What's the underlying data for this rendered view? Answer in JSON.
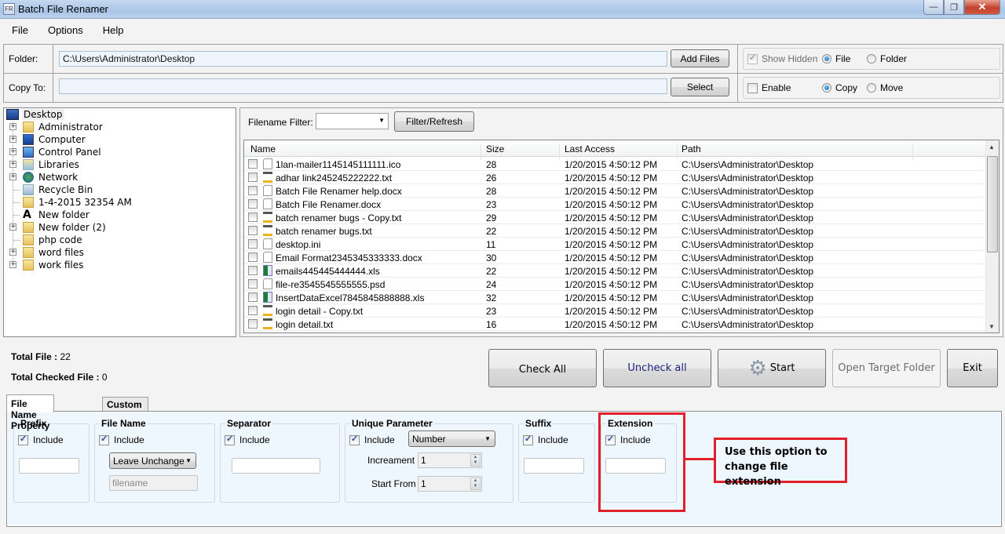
{
  "window": {
    "title": "Batch File Renamer",
    "minimize": "—",
    "restore": "❐",
    "close": "✕"
  },
  "menu": [
    "File",
    "Options",
    "Help"
  ],
  "folder": {
    "label": "Folder:",
    "value": "C:\\Users\\Administrator\\Desktop",
    "button": "Add Files"
  },
  "copy_to": {
    "label": "Copy To:",
    "value": "",
    "button": "Select"
  },
  "options_top": {
    "show_hidden": {
      "label": "Show Hidden",
      "checked": true,
      "disabled": true
    },
    "file": {
      "label": "File",
      "selected": true
    },
    "folder": {
      "label": "Folder",
      "selected": false
    }
  },
  "options_copy": {
    "enable": {
      "label": "Enable",
      "checked": false
    },
    "copy": {
      "label": "Copy",
      "selected": true
    },
    "move": {
      "label": "Move",
      "selected": false
    }
  },
  "tree": {
    "root": "Desktop",
    "items": [
      {
        "label": "Administrator",
        "icon": "user-folder-icon",
        "expandable": true
      },
      {
        "label": "Computer",
        "icon": "computer-icon",
        "expandable": true
      },
      {
        "label": "Control Panel",
        "icon": "control-panel-icon",
        "expandable": true
      },
      {
        "label": "Libraries",
        "icon": "libraries-icon",
        "expandable": true
      },
      {
        "label": "Network",
        "icon": "network-icon",
        "expandable": true
      },
      {
        "label": "Recycle Bin",
        "icon": "recycle-bin-icon",
        "expandable": false
      },
      {
        "label": "1-4-2015 32354 AM",
        "icon": "folder-icon",
        "expandable": false
      },
      {
        "label": "New folder",
        "icon": "font-folder-icon",
        "expandable": false
      },
      {
        "label": "New folder (2)",
        "icon": "folder-icon",
        "expandable": true
      },
      {
        "label": "php code",
        "icon": "folder-icon",
        "expandable": false
      },
      {
        "label": "word files",
        "icon": "folder-icon",
        "expandable": true
      },
      {
        "label": "work files",
        "icon": "folder-icon",
        "expandable": true
      }
    ]
  },
  "filter": {
    "label": "Filename Filter:",
    "value": "",
    "button": "Filter/Refresh"
  },
  "grid": {
    "columns": [
      "Name",
      "Size",
      "Last Access",
      "Path"
    ],
    "rows": [
      {
        "name": "1lan-mailer1145145111111.ico",
        "size": "28",
        "access": "1/20/2015 4:50:12 PM",
        "path": "C:\\Users\\Administrator\\Desktop",
        "icon": "generic-file-icon"
      },
      {
        "name": "adhar link245245222222.txt",
        "size": "26",
        "access": "1/20/2015 4:50:12 PM",
        "path": "C:\\Users\\Administrator\\Desktop",
        "icon": "text-file-icon"
      },
      {
        "name": "Batch File Renamer help.docx",
        "size": "28",
        "access": "1/20/2015 4:50:12 PM",
        "path": "C:\\Users\\Administrator\\Desktop",
        "icon": "generic-file-icon"
      },
      {
        "name": "Batch File Renamer.docx",
        "size": "23",
        "access": "1/20/2015 4:50:12 PM",
        "path": "C:\\Users\\Administrator\\Desktop",
        "icon": "generic-file-icon"
      },
      {
        "name": "batch renamer bugs - Copy.txt",
        "size": "29",
        "access": "1/20/2015 4:50:12 PM",
        "path": "C:\\Users\\Administrator\\Desktop",
        "icon": "text-file-icon"
      },
      {
        "name": "batch renamer bugs.txt",
        "size": "22",
        "access": "1/20/2015 4:50:12 PM",
        "path": "C:\\Users\\Administrator\\Desktop",
        "icon": "text-file-icon"
      },
      {
        "name": "desktop.ini",
        "size": "11",
        "access": "1/20/2015 4:50:12 PM",
        "path": "C:\\Users\\Administrator\\Desktop",
        "icon": "generic-file-icon"
      },
      {
        "name": "Email Format2345345333333.docx",
        "size": "30",
        "access": "1/20/2015 4:50:12 PM",
        "path": "C:\\Users\\Administrator\\Desktop",
        "icon": "generic-file-icon"
      },
      {
        "name": "emails445445444444.xls",
        "size": "22",
        "access": "1/20/2015 4:50:12 PM",
        "path": "C:\\Users\\Administrator\\Desktop",
        "icon": "excel-file-icon"
      },
      {
        "name": "file-re3545545555555.psd",
        "size": "24",
        "access": "1/20/2015 4:50:12 PM",
        "path": "C:\\Users\\Administrator\\Desktop",
        "icon": "generic-file-icon"
      },
      {
        "name": "InsertDataExcel7845845888888.xls",
        "size": "32",
        "access": "1/20/2015 4:50:12 PM",
        "path": "C:\\Users\\Administrator\\Desktop",
        "icon": "excel-file-icon"
      },
      {
        "name": "login detail - Copy.txt",
        "size": "23",
        "access": "1/20/2015 4:50:12 PM",
        "path": "C:\\Users\\Administrator\\Desktop",
        "icon": "text-file-icon"
      },
      {
        "name": "login detail.txt",
        "size": "16",
        "access": "1/20/2015 4:50:12 PM",
        "path": "C:\\Users\\Administrator\\Desktop",
        "icon": "text-file-icon"
      }
    ]
  },
  "stats": {
    "total_label": "Total File :",
    "total_value": "22",
    "checked_label": "Total Checked File :",
    "checked_value": "0"
  },
  "actions": {
    "check_all": "Check All",
    "uncheck_all": "Uncheck all",
    "start": "Start",
    "open_target": "Open Target Folder",
    "exit": "Exit"
  },
  "tabs": [
    {
      "label": "File Name Property",
      "active": true
    },
    {
      "label": "Custom Rename",
      "active": false
    }
  ],
  "groups": {
    "prefix": {
      "title": "Prefix",
      "include": "Include",
      "checked": true,
      "value": ""
    },
    "file_name": {
      "title": "File Name",
      "include": "Include",
      "checked": true,
      "mode": "Leave Unchange",
      "placeholder": "filename"
    },
    "separator": {
      "title": "Separator",
      "include": "Include",
      "checked": true,
      "value": ""
    },
    "unique": {
      "title": "Unique Parameter",
      "include": "Include",
      "checked": true,
      "type": "Number",
      "increment_label": "Increament",
      "increment": "1",
      "start_label": "Start From",
      "start": "1"
    },
    "suffix": {
      "title": "Suffix",
      "include": "Include",
      "checked": true,
      "value": ""
    },
    "extension": {
      "title": "Extension",
      "include": "Include",
      "checked": true,
      "value": ""
    }
  },
  "annotation": {
    "text": "Use this option to change file extension",
    "color": "#e0202a"
  }
}
